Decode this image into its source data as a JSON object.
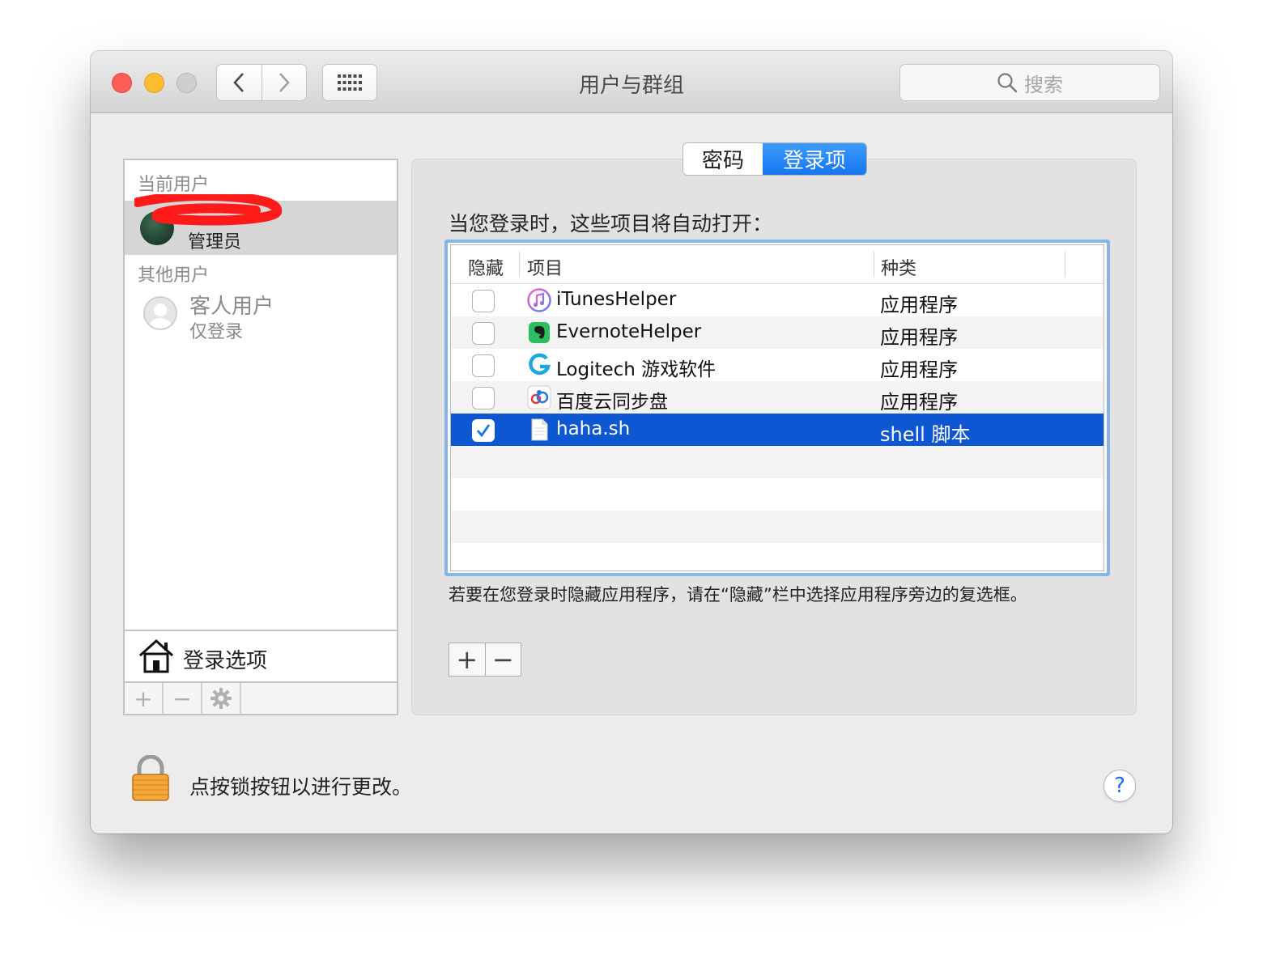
{
  "window": {
    "title": "用户与群组"
  },
  "toolbar": {
    "search_placeholder": "搜索"
  },
  "sidebar": {
    "current_users_label": "当前用户",
    "current_user": {
      "role": "管理员"
    },
    "other_users_label": "其他用户",
    "guest": {
      "name": "客人用户",
      "subtitle": "仅登录"
    },
    "login_options_label": "登录选项",
    "bottom_buttons": {
      "add": "+",
      "remove": "−"
    }
  },
  "tabs": [
    {
      "label": "密码",
      "selected": false
    },
    {
      "label": "登录项",
      "selected": true
    }
  ],
  "login_items": {
    "intro": "当您登录时，这些项目将自动打开：",
    "columns": {
      "hide": "隐藏",
      "item": "项目",
      "kind": "种类"
    },
    "rows": [
      {
        "name": "iTunesHelper",
        "kind": "应用程序",
        "hidden": false,
        "icon": "itunes-icon"
      },
      {
        "name": "EvernoteHelper",
        "kind": "应用程序",
        "hidden": false,
        "icon": "evernote-icon"
      },
      {
        "name": "Logitech 游戏软件",
        "kind": "应用程序",
        "hidden": false,
        "icon": "logitech-icon"
      },
      {
        "name": "百度云同步盘",
        "kind": "应用程序",
        "hidden": false,
        "icon": "baidu-cloud-icon"
      },
      {
        "name": "haha.sh",
        "kind": "shell 脚本",
        "hidden": true,
        "icon": "document-icon",
        "selected": true
      }
    ],
    "note": "若要在您登录时隐藏应用程序，请在“隐藏”栏中选择应用程序旁边的复选框。",
    "add": "+",
    "remove": "−"
  },
  "footer": {
    "lock_text": "点按锁按钮以进行更改。",
    "help": "?"
  },
  "colors": {
    "accent": "#1576f0",
    "selection": "#0d57d2",
    "focus_ring": "#8ab3ea"
  }
}
